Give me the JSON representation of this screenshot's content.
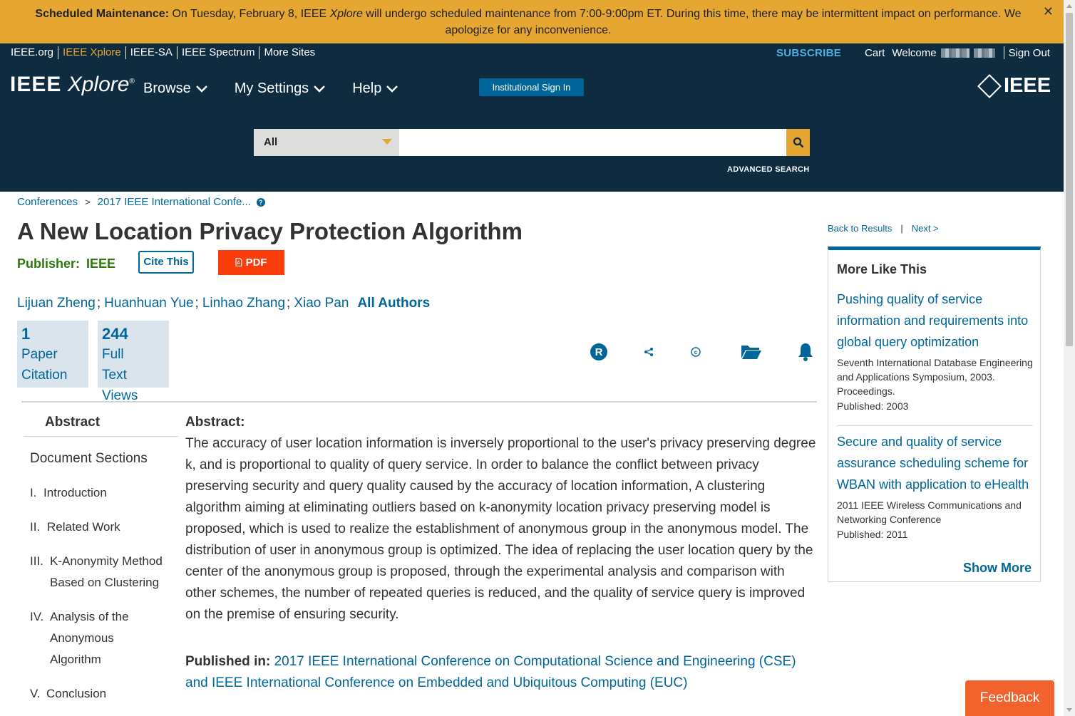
{
  "banner": {
    "title": "Scheduled Maintenance:",
    "text_1": " On Tuesday, February 8, IEEE ",
    "text_italic": "Xplore",
    "text_2": " will undergo scheduled maintenance from 7:00-9:00pm ET. During this time, there may be intermittent impact on performance. We apologize for any inconvenience.",
    "close": "✕"
  },
  "utility": {
    "links": [
      "IEEE.org",
      "IEEE Xplore",
      "IEEE-SA",
      "IEEE Spectrum",
      "More Sites"
    ],
    "subscribe": "SUBSCRIBE",
    "cart": "Cart",
    "welcome": "Welcome",
    "sign_out": "Sign Out"
  },
  "header": {
    "logo_bold": "IEEE",
    "logo_italic": "Xplore",
    "logo_reg": "®",
    "nav": [
      "Browse",
      "My Settings",
      "Help"
    ],
    "institutional_sign_in": "Institutional Sign In",
    "ieee_logo": "IEEE",
    "search_scope": "All",
    "search_placeholder": "",
    "advanced_search": "ADVANCED SEARCH"
  },
  "breadcrumb": {
    "items": [
      "Conferences",
      "2017 IEEE International Confe..."
    ],
    "separator": ">"
  },
  "article": {
    "title": "A New Location Privacy Protection Algorithm",
    "publisher_label": "Publisher:",
    "publisher": "IEEE",
    "cite_this": "Cite This",
    "pdf": "PDF",
    "authors": [
      "Lijuan Zheng",
      "Huanhuan Yue",
      "Linhao Zhang",
      "Xiao Pan"
    ],
    "all_authors": "All Authors",
    "metrics": [
      {
        "value": "1",
        "label_1": "Paper",
        "label_2": "Citation",
        "label_3": ""
      },
      {
        "value": "244",
        "label_1": "Full",
        "label_2": "Text",
        "label_3": "Views"
      }
    ],
    "action_icons": [
      "rights-icon",
      "share-icon",
      "copyright-icon",
      "folder-icon",
      "bell-icon"
    ]
  },
  "sections": {
    "abstract_tab": "Abstract",
    "document_sections": "Document Sections",
    "toc": [
      {
        "num": "I.",
        "title": "Introduction"
      },
      {
        "num": "II.",
        "title": "Related Work"
      },
      {
        "num": "III.",
        "title": "K-Anonymity Method Based on Clustering"
      },
      {
        "num": "IV.",
        "title": "Analysis of the Anonymous Algorithm"
      },
      {
        "num": "V.",
        "title": "Conclusion"
      }
    ]
  },
  "abstract": {
    "heading": "Abstract:",
    "body": "The accuracy of user location information is inversely proportional to the user's privacy preserving degree k, and is proportional to quality of query service. In order to balance the conflict between privacy preserving security and query quality caused by the accuracy of location information, A clustering algorithm aiming at eliminating outliers based on k-anonymity location privacy preserving model is proposed, which is used to realize the establishment of anonymous group in the anonymous model. The distribution of user in anonymous group is optimized. The idea of replacing the user location query by the center of the anonymous group is proposed, through the experimental analysis and comparison with other schemes, the number of repeated queries is reduced, and the quality of service query is improved on the premise of ensuring security.",
    "published_in_label": "Published in:",
    "published_in": "2017 IEEE International Conference on Computational Science and Engineering (CSE) and IEEE International Conference on Embedded and Ubiquitous Computing (EUC)"
  },
  "sidebar": {
    "back_to_results": "Back to Results",
    "separator": "|",
    "next": "Next >",
    "more_like_this": "More Like This",
    "items": [
      {
        "title": "Pushing quality of service information and requirements into global query optimization",
        "source": "Seventh International Database Engineering and Applications Symposium, 2003. Proceedings.",
        "published": "Published: 2003"
      },
      {
        "title": "Secure and quality of service assurance scheduling scheme for WBAN with application to eHealth",
        "source": "2011 IEEE Wireless Communications and Networking Conference",
        "published": "Published: 2011"
      }
    ],
    "show_more": "Show More"
  },
  "feedback": "Feedback",
  "colors": {
    "banner": "#e5a632",
    "header": "#0e2b3f",
    "link": "#006699",
    "publisher": "#2b7a0b",
    "pdf": "#fa3c0b",
    "feedback": "#f1622d"
  }
}
